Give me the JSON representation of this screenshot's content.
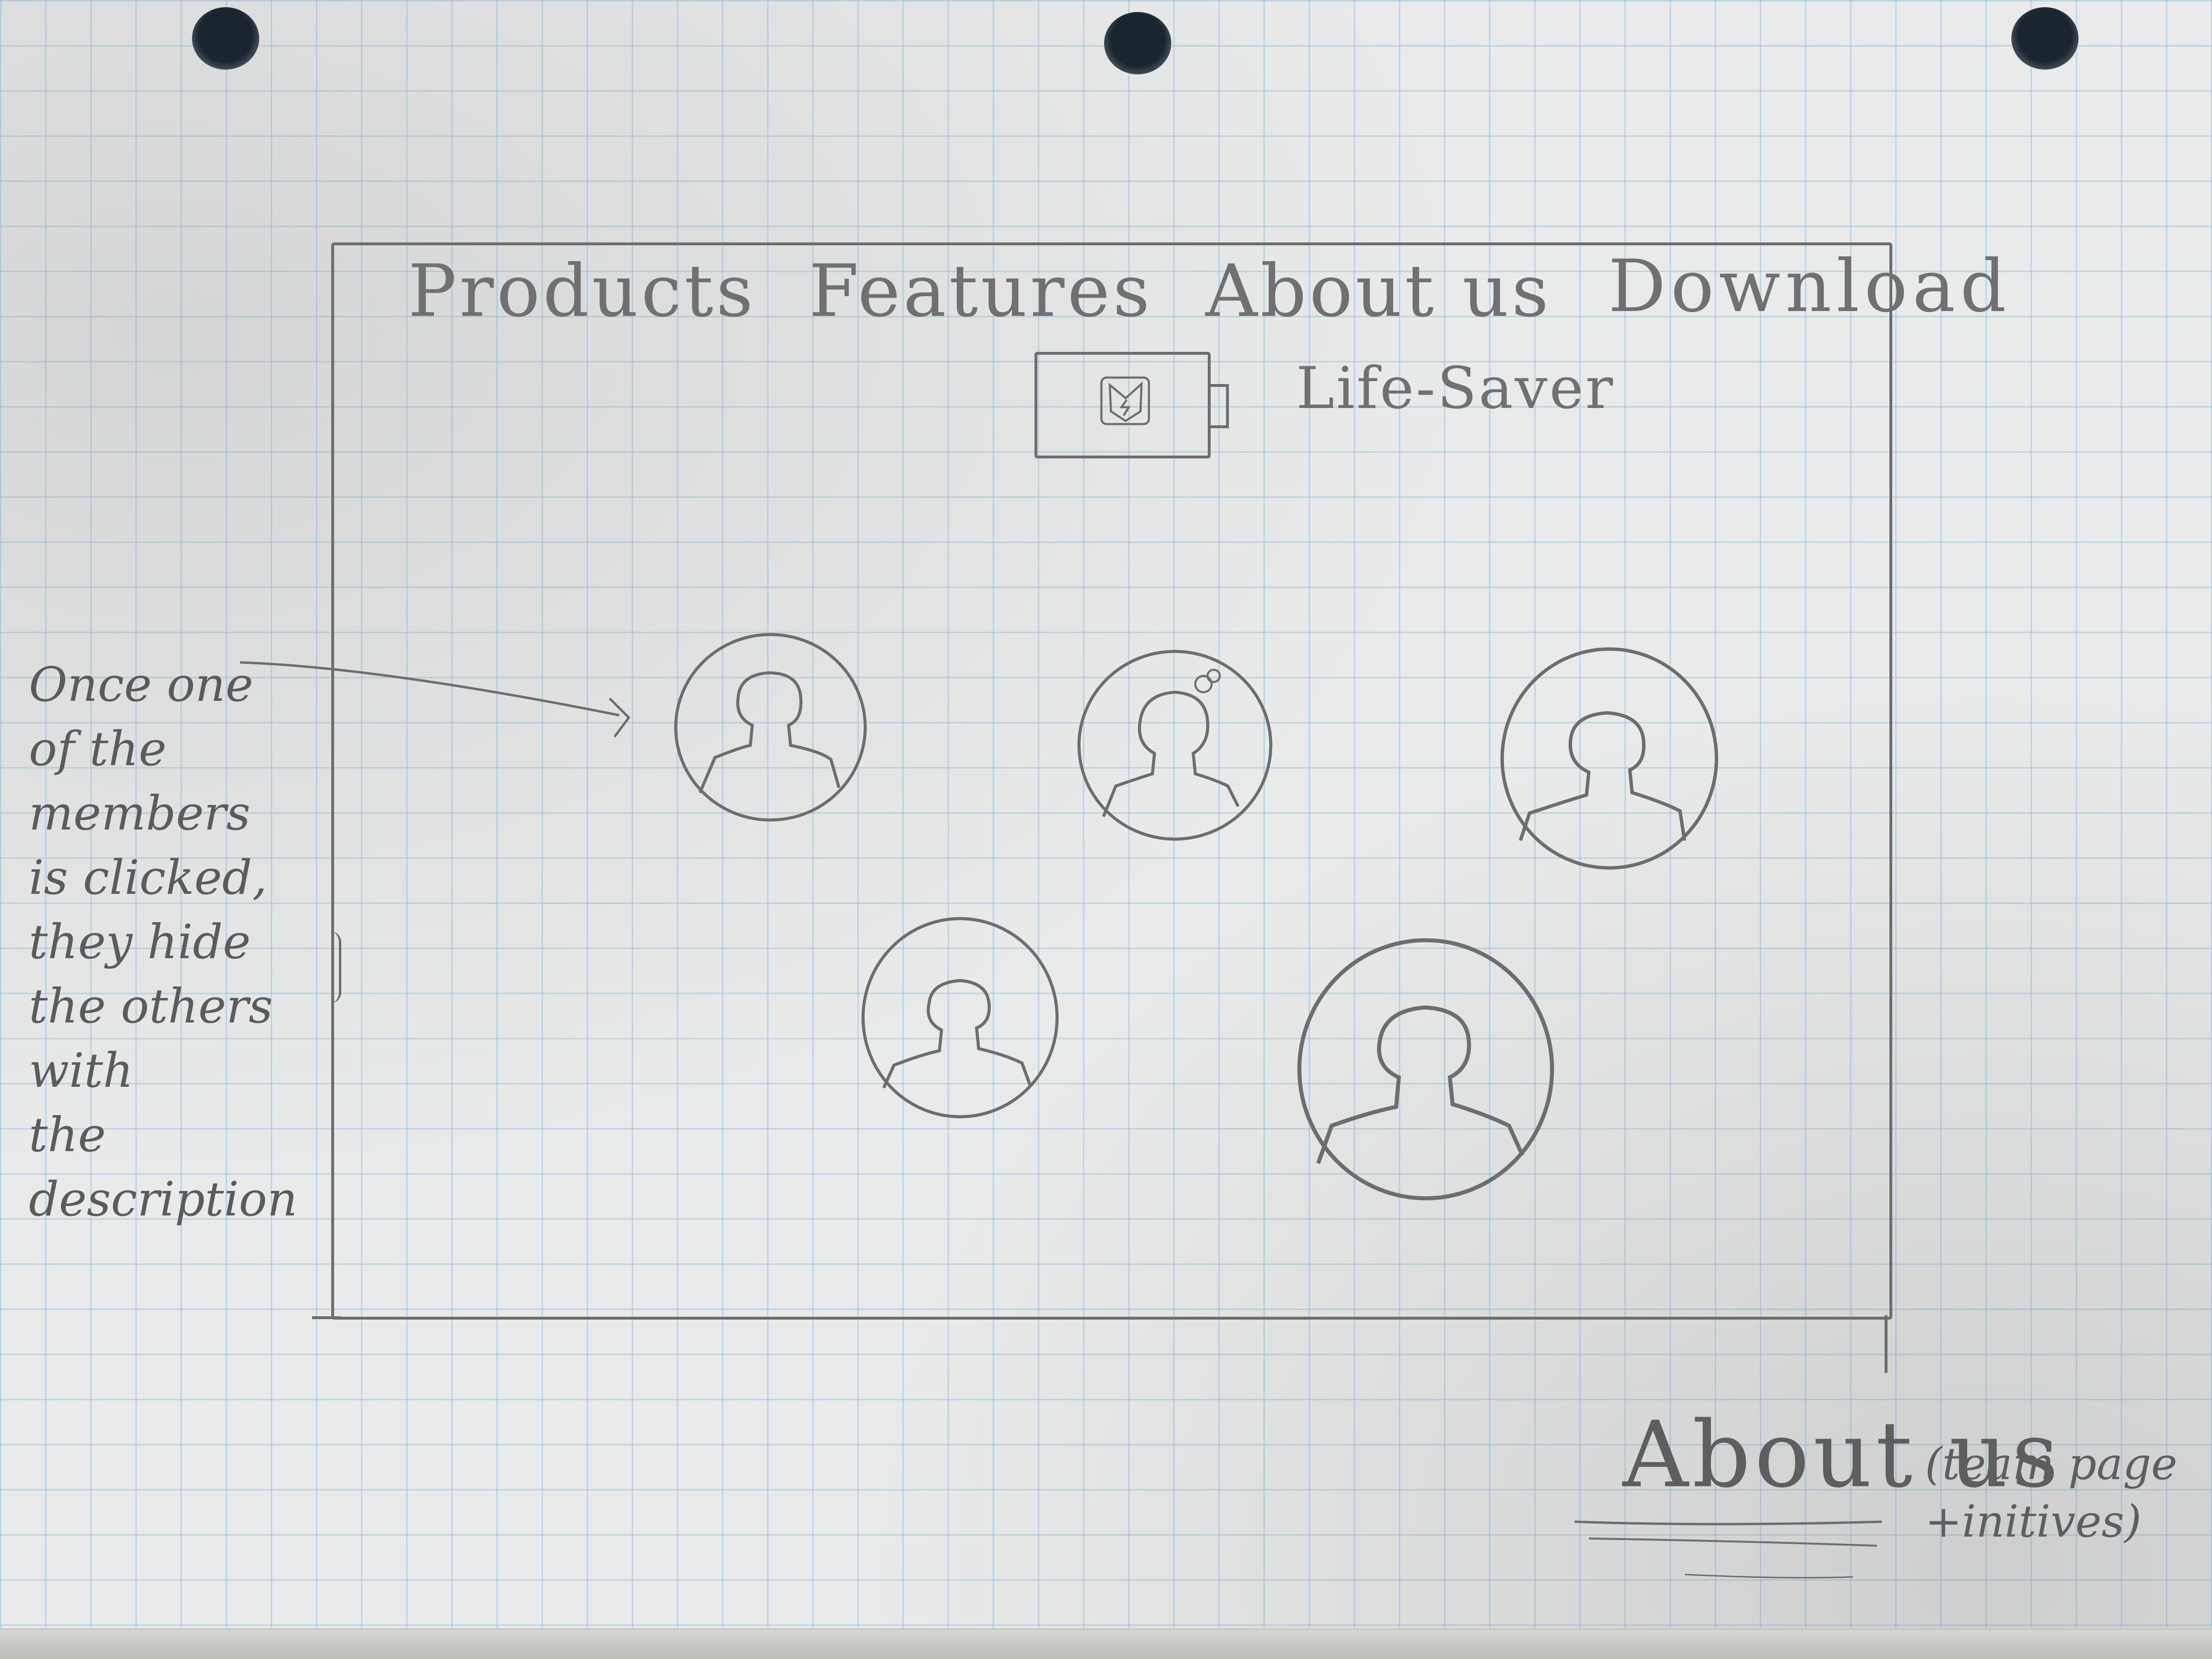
{
  "nav": {
    "items": [
      "Products",
      "Features",
      "About us"
    ],
    "download": "Download"
  },
  "logo": {
    "icon": "battery-heart-icon",
    "name": "Life-Saver"
  },
  "team": {
    "members": 5
  },
  "annotation": {
    "lines": [
      "Once one",
      "of the members",
      "is clicked,",
      "they hide",
      "the others with",
      "the description"
    ]
  },
  "page": {
    "label": "About us",
    "note_line1": "(team page",
    "note_line2": "+initives)"
  },
  "colors": {
    "paper": "#e9ebea",
    "grid": "#8cb9d7",
    "pencil": "#6d6d6d"
  }
}
